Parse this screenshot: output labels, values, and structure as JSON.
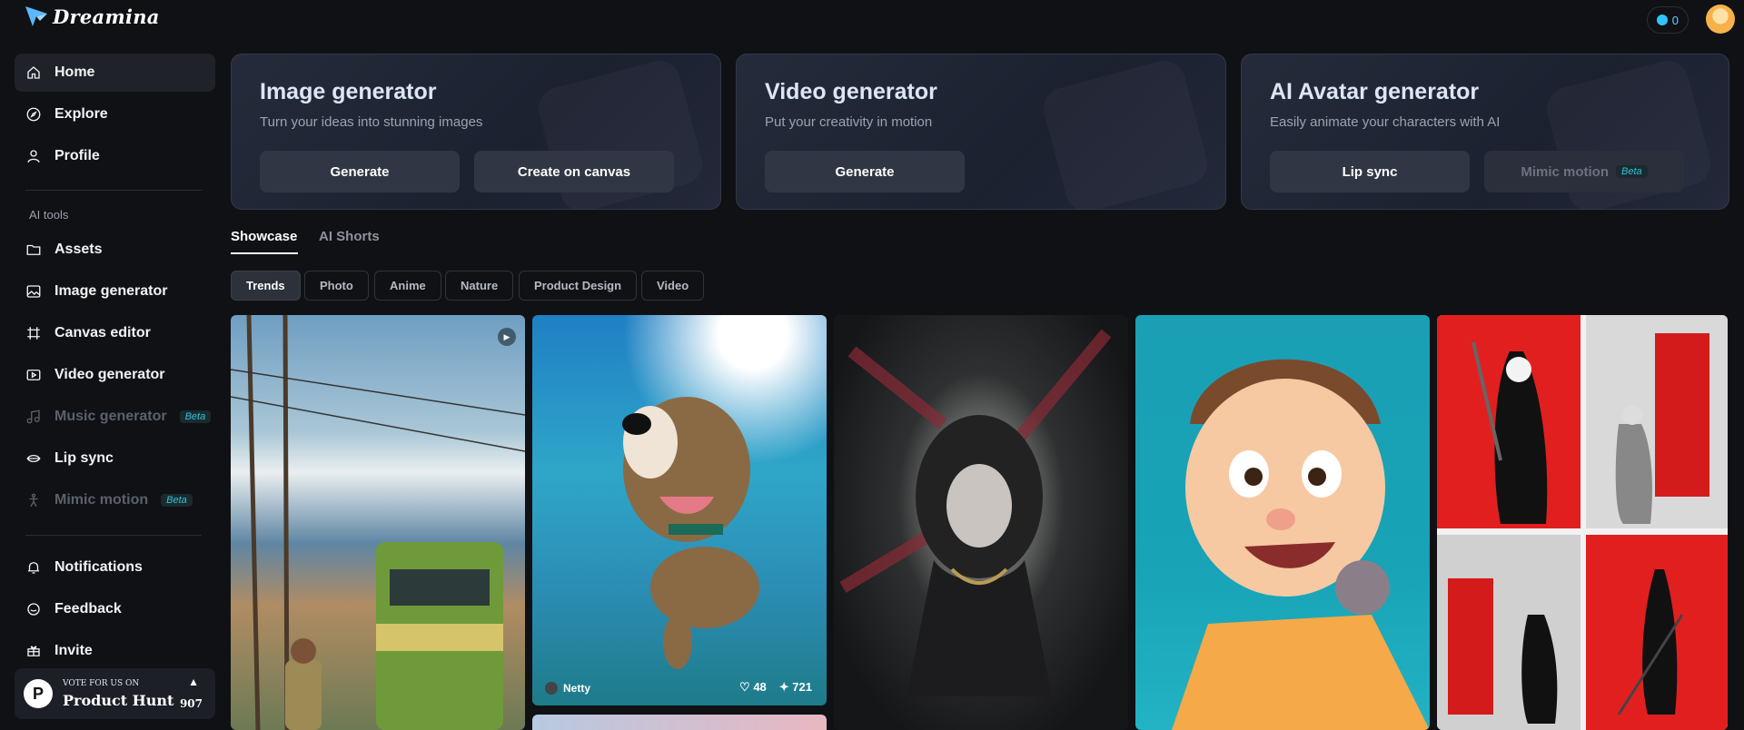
{
  "app": {
    "name": "Dreamina",
    "credits": "0"
  },
  "sidebar": {
    "items": [
      {
        "label": "Home",
        "icon": "home-icon",
        "active": true
      },
      {
        "label": "Explore",
        "icon": "compass-icon"
      },
      {
        "label": "Profile",
        "icon": "user-icon"
      }
    ],
    "section_label": "AI tools",
    "tools": [
      {
        "label": "Assets",
        "icon": "folder-icon"
      },
      {
        "label": "Image generator",
        "icon": "image-icon"
      },
      {
        "label": "Canvas editor",
        "icon": "canvas-icon"
      },
      {
        "label": "Video generator",
        "icon": "video-icon"
      },
      {
        "label": "Music generator",
        "icon": "music-icon",
        "badge": "Beta",
        "disabled": true
      },
      {
        "label": "Lip sync",
        "icon": "lips-icon"
      },
      {
        "label": "Mimic motion",
        "icon": "motion-icon",
        "badge": "Beta",
        "disabled": true
      }
    ],
    "bottom": [
      {
        "label": "Notifications",
        "icon": "bell-icon"
      },
      {
        "label": "Feedback",
        "icon": "chat-icon"
      },
      {
        "label": "Invite",
        "icon": "invite-icon"
      }
    ],
    "product_hunt": {
      "top": "VOTE FOR US ON",
      "name": "Product Hunt",
      "count": "907",
      "logo": "P"
    }
  },
  "cards": [
    {
      "title": "Image generator",
      "subtitle": "Turn your ideas into stunning images",
      "buttons": [
        "Generate",
        "Create on canvas"
      ]
    },
    {
      "title": "Video generator",
      "subtitle": "Put your creativity in motion",
      "buttons": [
        "Generate"
      ]
    },
    {
      "title": "AI Avatar generator",
      "subtitle": "Easily animate your characters with AI",
      "buttons": [
        "Lip sync",
        "Mimic motion"
      ],
      "badge": "Beta"
    }
  ],
  "tabs": [
    "Showcase",
    "AI Shorts"
  ],
  "chips": [
    "Trends",
    "Photo",
    "Anime",
    "Nature",
    "Product Design",
    "Video"
  ],
  "gallery": {
    "tile2": {
      "author": "Netty",
      "likes": "48",
      "remixes": "721"
    }
  },
  "colors": {
    "background": "#0f1115",
    "accent": "#2ec4ff"
  }
}
